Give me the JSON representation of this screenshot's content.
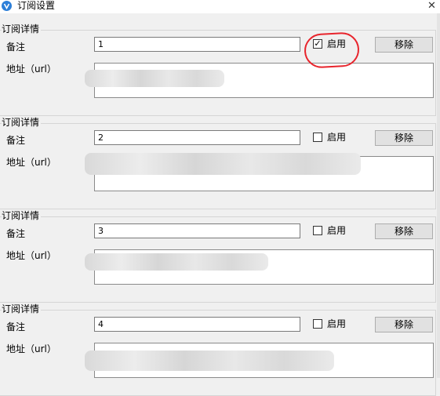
{
  "window": {
    "title": "订阅设置",
    "close_glyph": "✕"
  },
  "groups": [
    {
      "group_title": "订阅详情",
      "note_label": "备注",
      "note_value": "1",
      "enabled": true,
      "enable_label": "启用",
      "url_label": "地址（url）",
      "remove_label": "移除"
    },
    {
      "group_title": "订阅详情",
      "note_label": "备注",
      "note_value": "2",
      "enabled": false,
      "enable_label": "启用",
      "url_label": "地址（url）",
      "remove_label": "移除"
    },
    {
      "group_title": "订阅详情",
      "note_label": "备注",
      "note_value": "3",
      "enabled": false,
      "enable_label": "启用",
      "url_label": "地址（url）",
      "remove_label": "移除"
    },
    {
      "group_title": "订阅详情",
      "note_label": "备注",
      "note_value": "4",
      "enabled": false,
      "enable_label": "启用",
      "url_label": "地址（url）",
      "remove_label": "移除"
    }
  ],
  "icons": {
    "app": "v2ray-icon",
    "check": "checkmark-icon"
  },
  "colors": {
    "annotation": "#e8242c",
    "app_icon": "#2d7fd8"
  }
}
